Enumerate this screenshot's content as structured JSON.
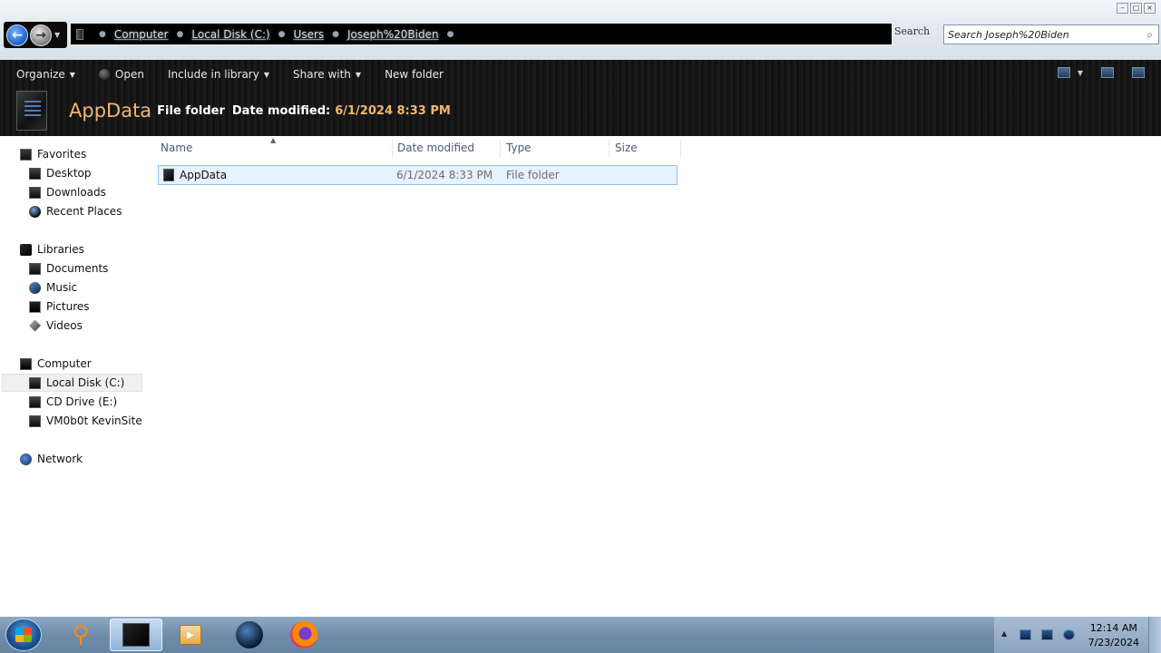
{
  "window": {
    "controls": [
      "minimize",
      "maximize",
      "close"
    ]
  },
  "address": {
    "crumbs": [
      "Computer",
      "Local Disk (C:)",
      "Users",
      "Joseph%20Biden"
    ]
  },
  "search": {
    "label": "Search",
    "value": "Search Joseph%20Biden"
  },
  "toolbar": {
    "organize": "Organize",
    "open": "Open",
    "include_in_library": "Include in library",
    "share_with": "Share with",
    "new_folder": "New folder"
  },
  "details": {
    "name": "AppData",
    "type": "File folder",
    "date_label": "Date modified:",
    "date_value": "6/1/2024 8:33 PM"
  },
  "nav": {
    "favorites": "Favorites",
    "desktop": "Desktop",
    "downloads": "Downloads",
    "recent_places": "Recent Places",
    "libraries": "Libraries",
    "documents": "Documents",
    "music": "Music",
    "pictures": "Pictures",
    "videos": "Videos",
    "computer": "Computer",
    "local_disk": "Local Disk (C:)",
    "cd_drive": "CD Drive (E:)",
    "vm_site": "VM0b0t KevinSite",
    "network": "Network"
  },
  "columns": {
    "name": "Name",
    "date_modified": "Date modified",
    "type": "Type",
    "size": "Size"
  },
  "files": [
    {
      "name": "AppData",
      "date": "6/1/2024 8:33 PM",
      "type": "File folder",
      "size": ""
    }
  ],
  "taskbar": {
    "time": "12:14 AM",
    "date": "7/23/2024"
  }
}
